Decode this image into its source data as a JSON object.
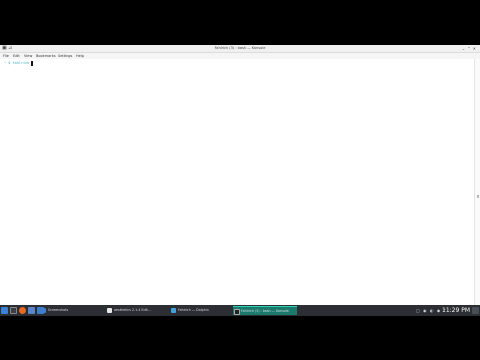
{
  "window": {
    "title": "Fahlrich (3) : bash — Konsole",
    "menu": [
      "File",
      "Edit",
      "View",
      "Bookmarks",
      "Settings",
      "Help"
    ]
  },
  "terminal": {
    "prompt": "~ $ fahlrich"
  },
  "taskbar": {
    "tasks": [
      {
        "label": "Screenshots",
        "color": "#3f7fd2",
        "active": false
      },
      {
        "label": "aesthetics 2.1.4 Edit...",
        "color": "#e8e8e8",
        "active": false
      },
      {
        "label": "Fahlrich — Dolphin",
        "color": "#43a3d8",
        "active": false
      },
      {
        "label": "Fahlrich (3) : bash — Konsole",
        "color": "#222",
        "active": true
      }
    ],
    "clock": "11:29 PM"
  },
  "colors": {
    "taskbar_bg": "#2b2e33",
    "active_task": "#1b7a6c",
    "prompt": "#3aa8c1"
  }
}
